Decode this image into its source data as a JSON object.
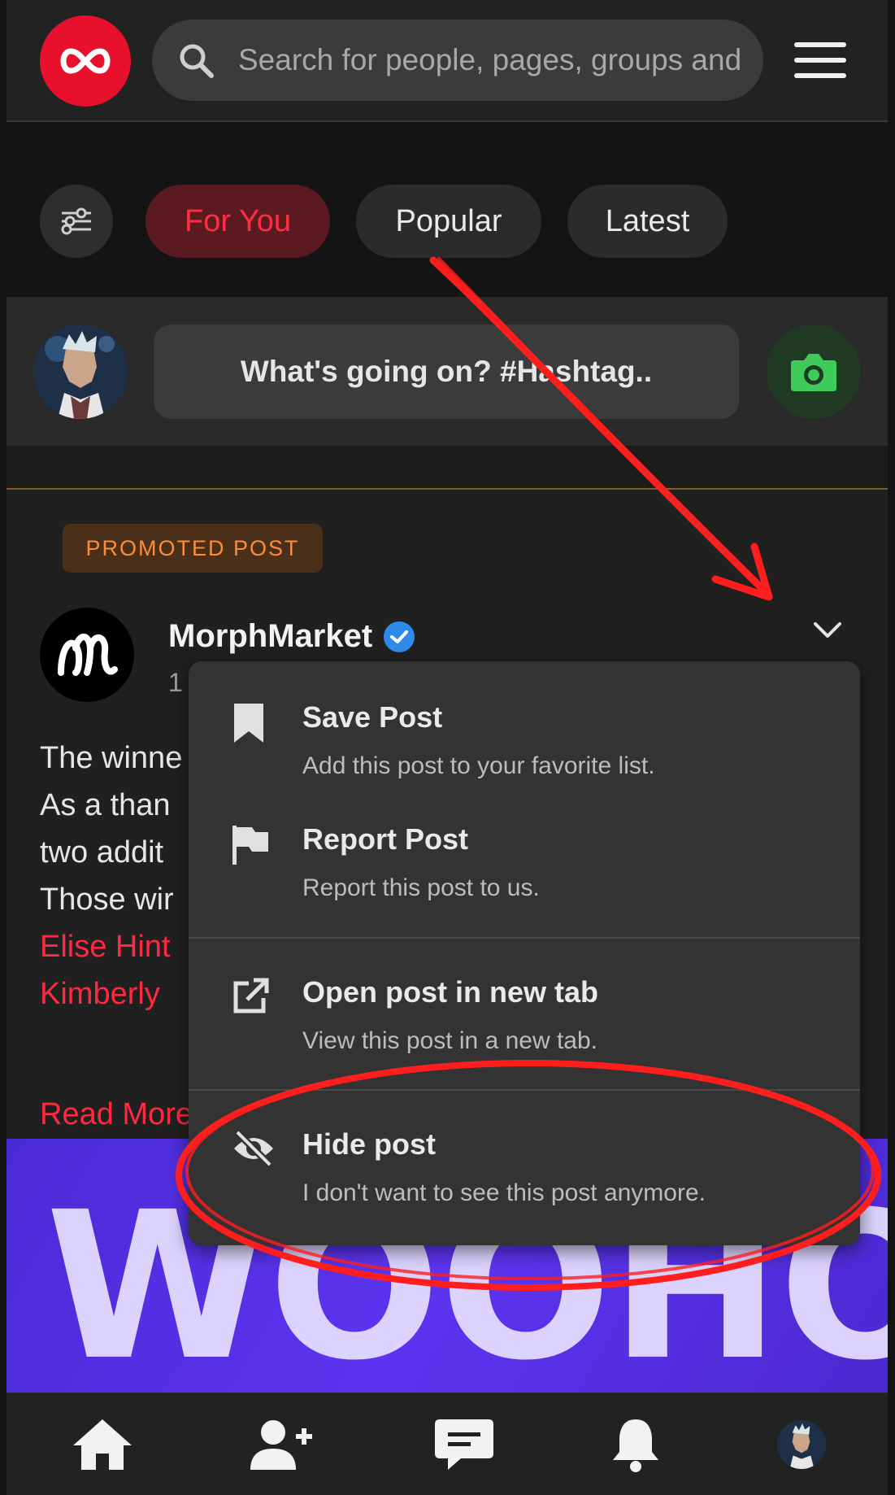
{
  "header": {
    "search_placeholder": "Search for people, pages, groups and #hashtags"
  },
  "tabs": {
    "items": [
      {
        "label": "For You",
        "active": true
      },
      {
        "label": "Popular",
        "active": false
      },
      {
        "label": "Latest",
        "active": false
      }
    ]
  },
  "composer": {
    "placeholder": "What's going on? #Hashtag.."
  },
  "post": {
    "badge": "PROMOTED POST",
    "author": "MorphMarket",
    "time": "1",
    "lines": [
      "The winne",
      "As a than",
      "two addit",
      "Those wir"
    ],
    "links": [
      "Elise Hint",
      "Kimberly"
    ],
    "read_more": "Read More",
    "banner_text": "WOOHOO"
  },
  "dropdown": {
    "items": [
      {
        "title": "Save Post",
        "desc": "Add this post to your favorite list.",
        "icon": "bookmark-icon"
      },
      {
        "title": "Report Post",
        "desc": "Report this post to us.",
        "icon": "flag-icon"
      },
      {
        "title": "Open post in new tab",
        "desc": "View this post in a new tab.",
        "icon": "external-link-icon"
      },
      {
        "title": "Hide post",
        "desc": "I don't want to see this post anymore.",
        "icon": "eye-slash-icon"
      }
    ]
  },
  "colors": {
    "accent": "#e8112d",
    "annotation": "#ff2020"
  }
}
